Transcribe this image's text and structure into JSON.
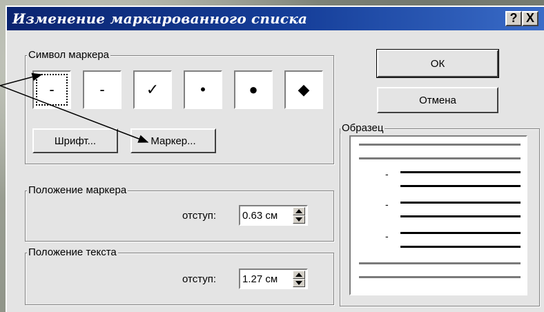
{
  "dialog": {
    "title": "Изменение маркированного списка",
    "help_button": "?",
    "close_button": "X"
  },
  "bullet_group": {
    "label": "Символ маркера",
    "symbols": [
      "-",
      "-",
      "✓",
      "•",
      "●",
      "◆"
    ],
    "selected_index": 0,
    "font_button": "Шрифт...",
    "marker_button": "Маркер..."
  },
  "marker_position": {
    "label": "Положение маркера",
    "indent_label": "отступ:",
    "indent_value": "0.63 см"
  },
  "text_position": {
    "label": "Положение текста",
    "indent_label": "отступ:",
    "indent_value": "1.27 см"
  },
  "buttons": {
    "ok": "ОК",
    "cancel": "Отмена"
  },
  "preview": {
    "label": "Образец",
    "bullets": [
      "-",
      "-",
      "-"
    ]
  }
}
